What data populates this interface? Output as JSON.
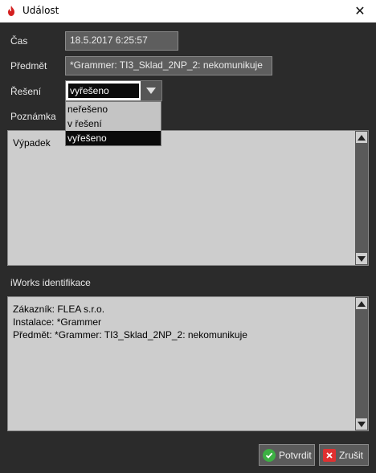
{
  "window": {
    "title": "Událost",
    "icon": "fire-icon",
    "close_icon": "close-icon"
  },
  "fields": {
    "cas": {
      "label": "Čas",
      "value": "18.5.2017 6:25:57"
    },
    "predmet": {
      "label": "Předmět",
      "value": "*Grammer: TI3_Sklad_2NP_2: nekomunikuje"
    },
    "reseni": {
      "label": "Řešení",
      "value": "vyřešeno",
      "options": [
        "neřešeno",
        "v řešení",
        "vyřešeno"
      ],
      "selected_index": 2
    },
    "poznamka": {
      "label": "Poznámka",
      "text": "Výpadek"
    },
    "iworks": {
      "label": "iWorks identifikace",
      "lines": [
        "Zákazník: FLEA s.r.o.",
        "Instalace: *Grammer",
        "Předmět: *Grammer: TI3_Sklad_2NP_2: nekomunikuje"
      ]
    }
  },
  "buttons": {
    "confirm": {
      "label": "Potvrdit",
      "icon": "check-icon",
      "color": "#3cb043"
    },
    "cancel": {
      "label": "Zrušit",
      "icon": "cross-icon",
      "color": "#e03030"
    }
  },
  "colors": {
    "background": "#2b2b2b",
    "field": "#5e5e5e",
    "textarea": "#cdcdcd",
    "titlebar": "#ffffff"
  }
}
